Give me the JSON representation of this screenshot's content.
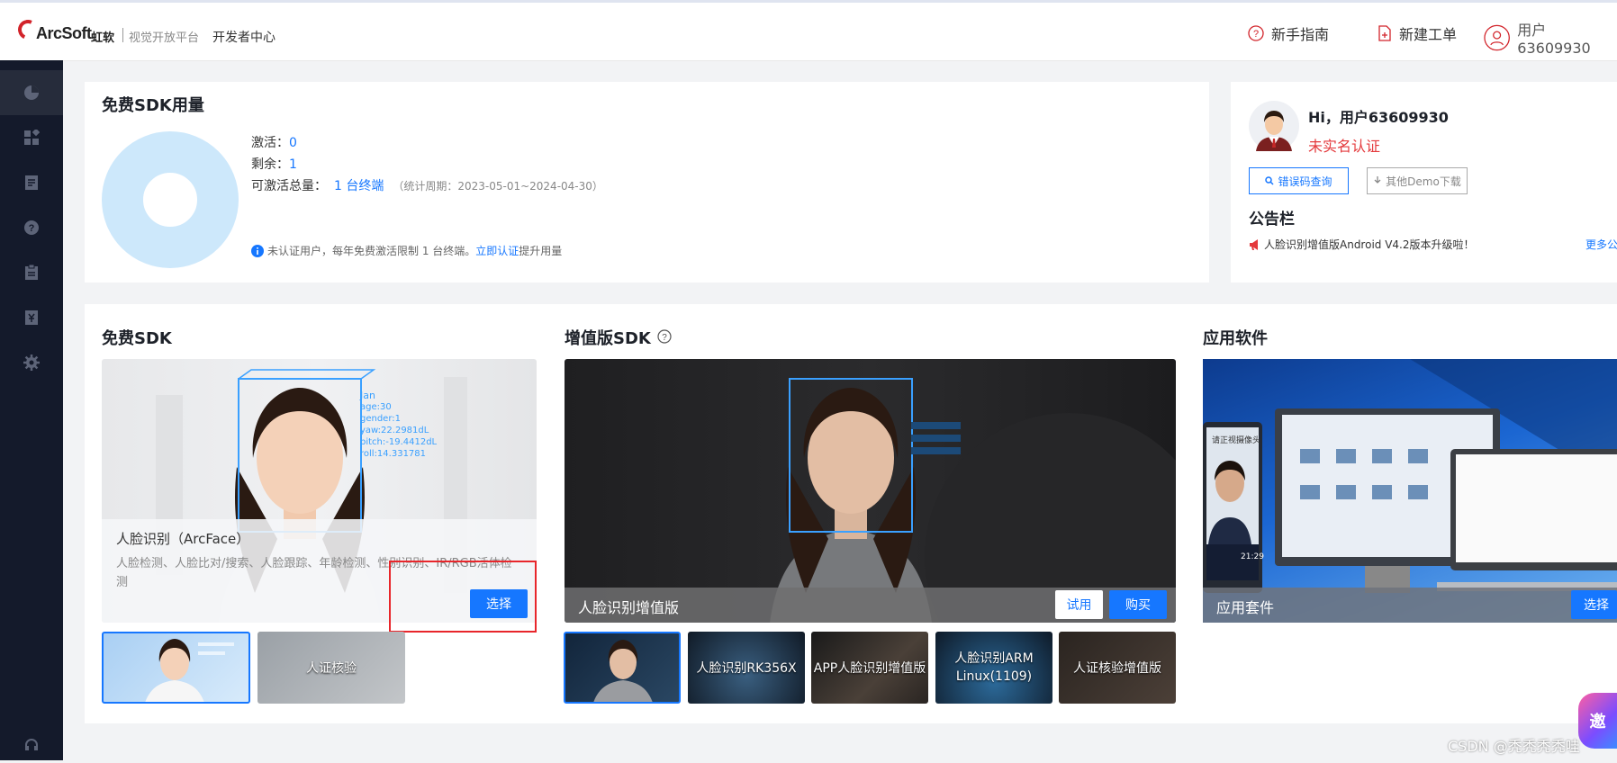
{
  "header": {
    "logo_text": "ArcSoft",
    "logo_cn": "虹软",
    "logo_sub": "视觉开放平台",
    "dev_center": "开发者中心",
    "guide": "新手指南",
    "new_ticket": "新建工单",
    "user": "用户63609930"
  },
  "sidebar": {
    "icons": [
      "dashboard-icon",
      "apps-icon",
      "document-icon",
      "help-icon",
      "clipboard-icon",
      "invoice-icon",
      "settings-icon",
      "headset-icon"
    ]
  },
  "usage": {
    "title": "免费SDK用量",
    "activated_label": "激活：",
    "activated_value": "0",
    "remaining_label": "剩余：",
    "remaining_value": "1",
    "total_label": "可激活总量：",
    "total_value": "1 台终端",
    "period": "（统计周期：2023-05-01~2024-04-30）",
    "notice": "未认证用户，每年免费激活限制 1 台终端。",
    "notice_link": "立即认证",
    "notice_tail": "提升用量",
    "donut_color": "#cde8fb"
  },
  "profile": {
    "greeting": "Hi，用户63609930",
    "status": "未实名认证",
    "error_btn": "错误码查询",
    "demo_btn": "其他Demo下载",
    "board_title": "公告栏",
    "announcement": "人脸识别增值版Android V4.2版本升级啦！",
    "more": "更多公"
  },
  "free_sdk": {
    "title": "免费SDK",
    "card_title": "人脸识别（ArcFace）",
    "card_desc": "人脸检测、人脸比对/搜索、人脸跟踪、年龄检测、性别识别、IR/RGB活体检测",
    "select_btn": "选择",
    "face_tags": [
      "Jan",
      "age:30",
      "gender:1",
      "yaw:22.2981dL",
      "pitch:-19.4412dL",
      "roll:14.331781"
    ],
    "thumb_2": "人证核验"
  },
  "premium_sdk": {
    "title": "增值版SDK",
    "banner_label": "人脸识别增值版",
    "trial_btn": "试用",
    "buy_btn": "购买",
    "thumbs": [
      "人脸识别RK356X",
      "APP人脸识别增值版",
      "人脸识别ARM Linux(1109)",
      "人证核验增值版"
    ]
  },
  "apps": {
    "title": "应用软件",
    "banner_label": "应用套件",
    "select_btn": "选择",
    "kiosk_text": "请正视摄像头",
    "kiosk_time": "21:29"
  },
  "watermark": "CSDN @秃秃秃秃哇",
  "float_badge": "邀"
}
